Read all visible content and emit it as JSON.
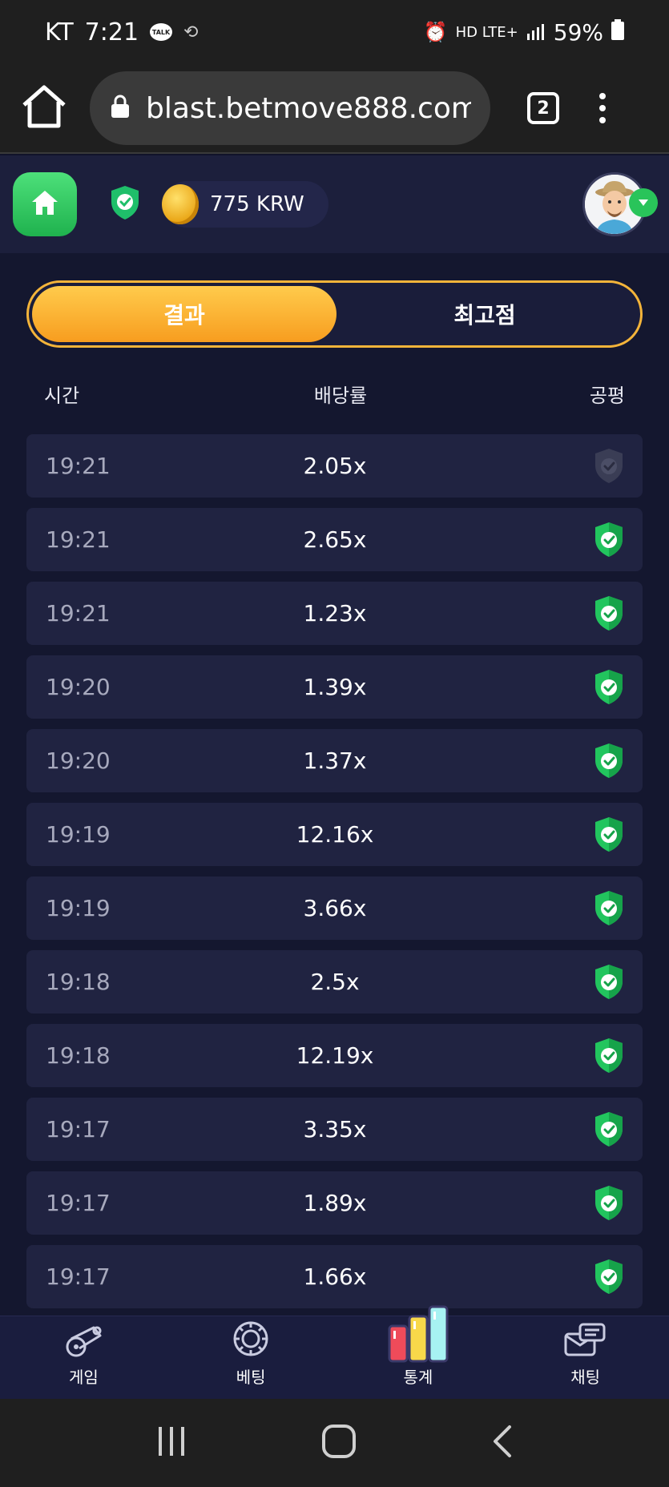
{
  "status_bar": {
    "carrier": "KT",
    "time": "7:21",
    "talk_badge": "TALK",
    "network": "HD LTE+",
    "battery": "59%"
  },
  "browser": {
    "url": "blast.betmove888.com/",
    "tab_count": "2"
  },
  "header": {
    "balance": "775 KRW"
  },
  "segmented": {
    "active_label": "결과",
    "inactive_label": "최고점"
  },
  "table": {
    "headers": {
      "time": "시간",
      "odds": "배당률",
      "fair": "공평"
    },
    "rows": [
      {
        "time": "19:21",
        "odds": "2.05x",
        "verified": false
      },
      {
        "time": "19:21",
        "odds": "2.65x",
        "verified": true
      },
      {
        "time": "19:21",
        "odds": "1.23x",
        "verified": true
      },
      {
        "time": "19:20",
        "odds": "1.39x",
        "verified": true
      },
      {
        "time": "19:20",
        "odds": "1.37x",
        "verified": true
      },
      {
        "time": "19:19",
        "odds": "12.16x",
        "verified": true
      },
      {
        "time": "19:19",
        "odds": "3.66x",
        "verified": true
      },
      {
        "time": "19:18",
        "odds": "2.5x",
        "verified": true
      },
      {
        "time": "19:18",
        "odds": "12.19x",
        "verified": true
      },
      {
        "time": "19:17",
        "odds": "3.35x",
        "verified": true
      },
      {
        "time": "19:17",
        "odds": "1.89x",
        "verified": true
      },
      {
        "time": "19:17",
        "odds": "1.66x",
        "verified": true
      }
    ]
  },
  "bottom_nav": {
    "items": [
      {
        "label": "게임",
        "icon": "cannon-icon"
      },
      {
        "label": "베팅",
        "icon": "chip-icon"
      },
      {
        "label": "통계",
        "icon": "bar-chart-icon",
        "active": true
      },
      {
        "label": "채팅",
        "icon": "chat-icon"
      }
    ]
  },
  "colors": {
    "accent": "#f7a928",
    "verified_green": "#22c55e",
    "unverified_gray": "#3a3d55",
    "row_bg": "#202341"
  }
}
